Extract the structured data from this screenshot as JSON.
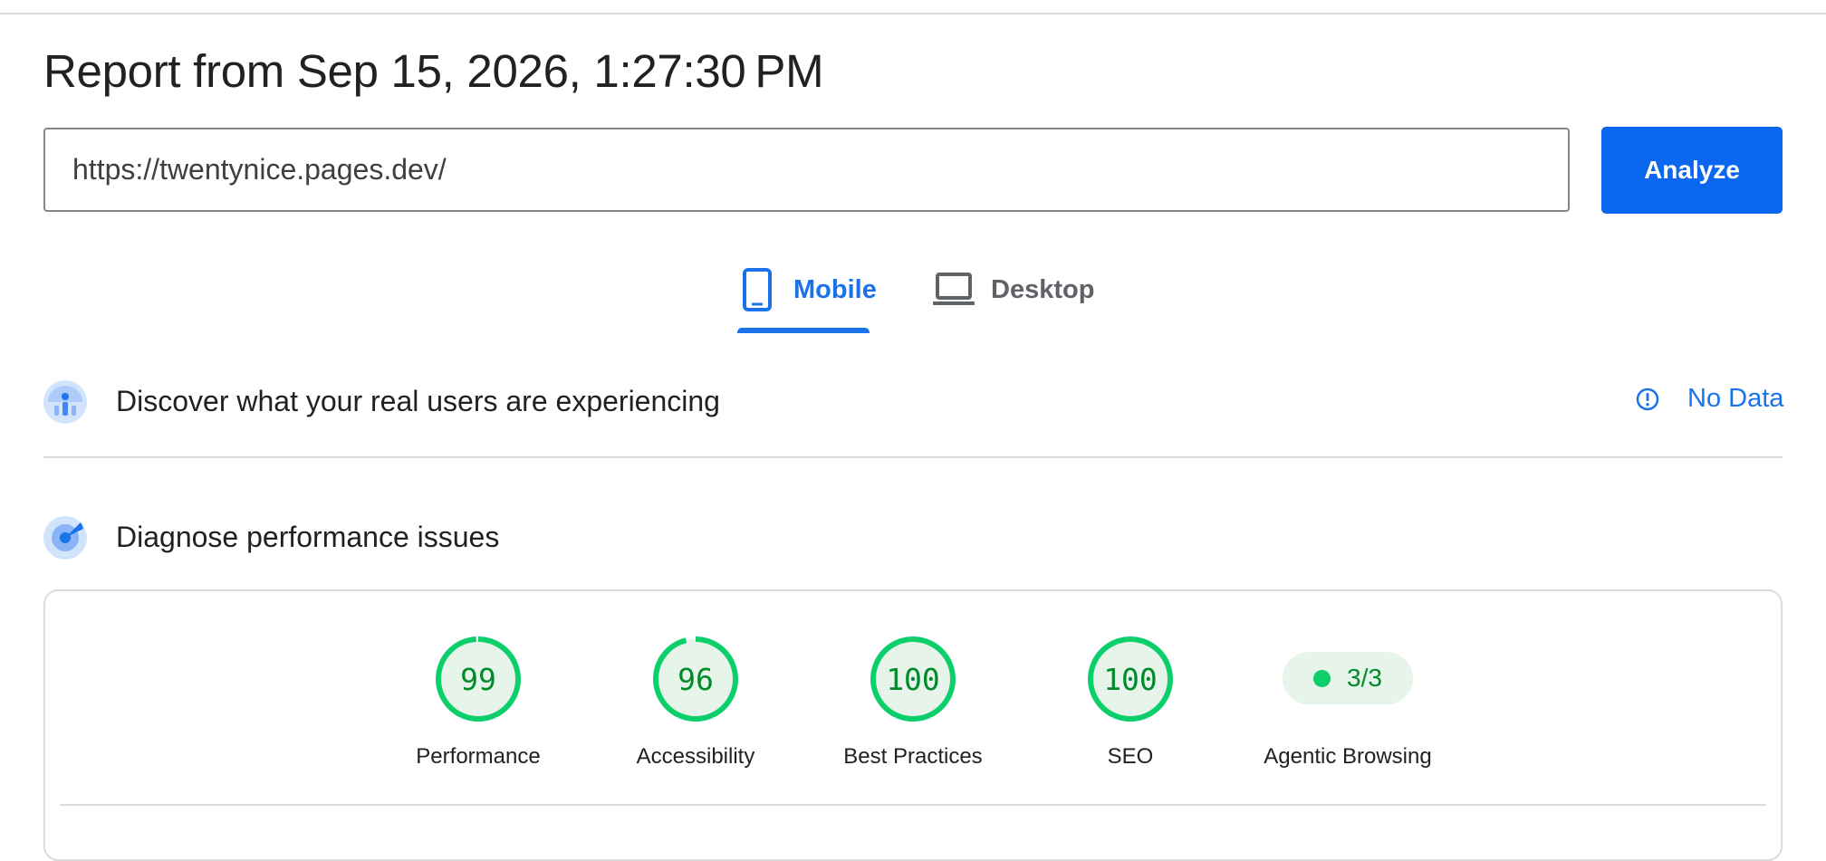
{
  "report": {
    "title": "Report from Sep 15, 2026, 1:27:30 PM"
  },
  "url_input": {
    "value": "https://twentynice.pages.dev/"
  },
  "analyze_label": "Analyze",
  "tabs": [
    {
      "label": "Mobile",
      "icon": "smartphone-icon",
      "selected": true
    },
    {
      "label": "Desktop",
      "icon": "laptop-icon",
      "selected": false
    }
  ],
  "field_data": {
    "title": "Discover what your real users are experiencing",
    "status_icon": "info-icon",
    "status": "No Data"
  },
  "diagnose": {
    "title": "Diagnose performance issues"
  },
  "scores": [
    {
      "value": "99",
      "label": "Performance",
      "fraction": 0.99
    },
    {
      "value": "96",
      "label": "Accessibility",
      "fraction": 0.96
    },
    {
      "value": "100",
      "label": "Best Practices",
      "fraction": 1.0
    },
    {
      "value": "100",
      "label": "SEO",
      "fraction": 1.0
    }
  ],
  "agentic": {
    "value": "3/3",
    "label": "Agentic Browsing"
  },
  "colors": {
    "accent": "#1a73e8",
    "button": "#0b66f0",
    "pass": "#0cce6b",
    "pass_text": "#008a29",
    "pass_bg": "#e6f4ea"
  }
}
